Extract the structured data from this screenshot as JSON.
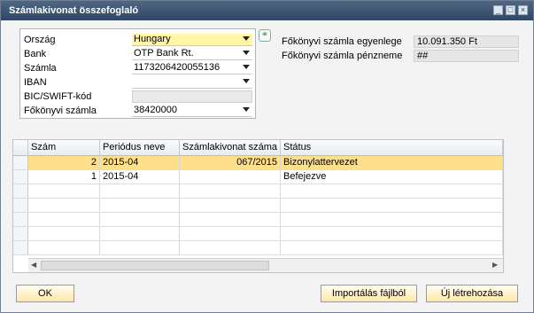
{
  "window": {
    "title": "Számlakivonat összefoglaló"
  },
  "colors": {
    "title_bar": "#3e5673",
    "highlight_row": "#ffe08a",
    "required_field": "#fff6a8",
    "button_bg": "#ffe8a8"
  },
  "form": {
    "country_label": "Ország",
    "country_value": "Hungary",
    "bank_label": "Bank",
    "bank_value": "OTP Bank Rt.",
    "account_label": "Számla",
    "account_value": "1173206420055136",
    "iban_label": "IBAN",
    "iban_value": "",
    "bic_label": "BIC/SWIFT-kód",
    "bic_value": "",
    "gl_label": "Főkönyvi számla",
    "gl_value": "38420000"
  },
  "summary": {
    "balance_label": "Főkönyvi számla egyenlege",
    "balance_value": "10.091.350 Ft",
    "currency_label": "Főkönyvi számla pénzneme",
    "currency_value": "##"
  },
  "grid": {
    "headers": [
      "Szám",
      "Periódus neve",
      "Számlakivonat száma",
      "Státus"
    ],
    "rows": [
      {
        "number": "2",
        "period": "2015-04",
        "statement": "067/2015",
        "status": "Bizonylattervezet"
      },
      {
        "number": "1",
        "period": "2015-04",
        "statement": "",
        "status": "Befejezve"
      }
    ]
  },
  "buttons": {
    "ok": "OK",
    "import": "Importálás fájlból",
    "create_new": "Új létrehozása"
  }
}
